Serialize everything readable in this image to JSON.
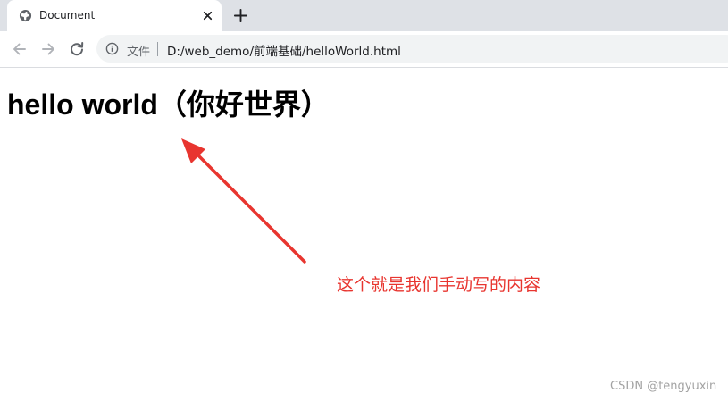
{
  "tab": {
    "title": "Document",
    "favicon": "globe-icon",
    "close_icon": "close-icon"
  },
  "tabstrip": {
    "new_tab_icon": "plus-icon"
  },
  "toolbar": {
    "back_icon": "arrow-left-icon",
    "forward_icon": "arrow-right-icon",
    "reload_icon": "reload-icon"
  },
  "omnibox": {
    "info_icon": "info-icon",
    "scheme_label": "文件",
    "url": "D:/web_demo/前端基础/helloWorld.html"
  },
  "page": {
    "heading": "hello world（你好世界）"
  },
  "annotation": {
    "note": "这个就是我们手动写的内容",
    "color": "#e8352f"
  },
  "watermark": {
    "text": "CSDN @tengyuxin"
  },
  "colors": {
    "tabstrip_bg": "#dee1e6",
    "omnibox_bg": "#f1f3f4",
    "icon_gray": "#5f6368"
  }
}
